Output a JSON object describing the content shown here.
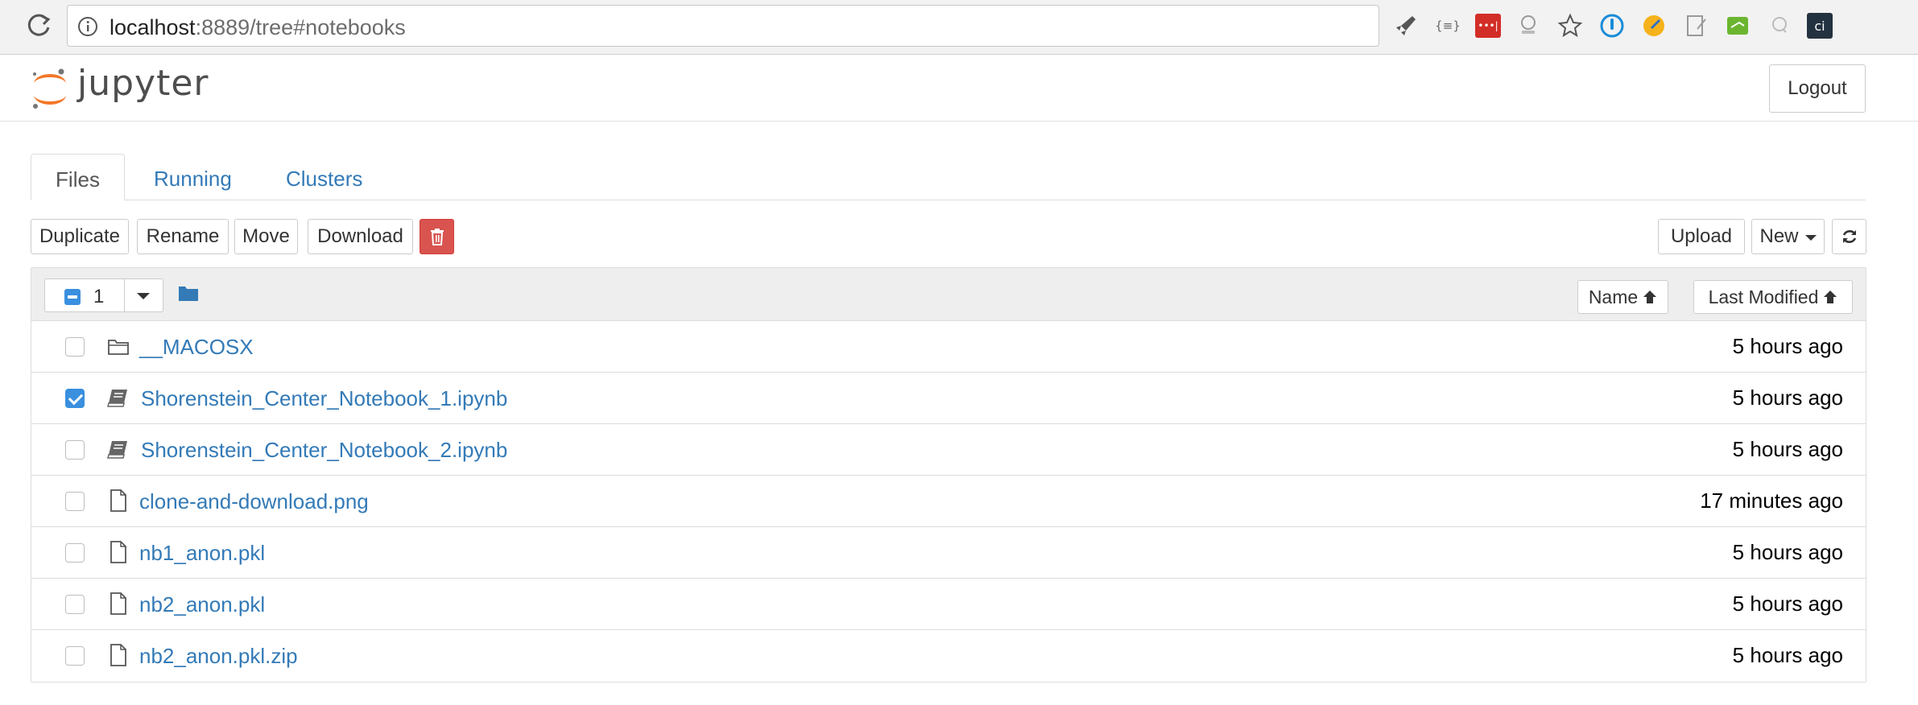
{
  "browser": {
    "url_host": "localhost",
    "url_rest": ":8889/tree#notebooks",
    "extensions": [
      "rocket-icon",
      "braces-icon",
      "lastpass-icon",
      "extension-icon",
      "star-icon",
      "onepassword-icon",
      "rocket-color-icon",
      "notes-icon",
      "evernote-icon",
      "chat-icon",
      "ci-icon"
    ],
    "ci_label": "ci",
    "braces_label": "{≡}",
    "lastpass_label": "•••|"
  },
  "header": {
    "logo_text": "jupyter",
    "logout_label": "Logout"
  },
  "tabs": [
    {
      "label": "Files",
      "active": true
    },
    {
      "label": "Running",
      "active": false
    },
    {
      "label": "Clusters",
      "active": false
    }
  ],
  "toolbar": {
    "duplicate_label": "Duplicate",
    "rename_label": "Rename",
    "move_label": "Move",
    "download_label": "Download",
    "upload_label": "Upload",
    "new_label": "New"
  },
  "list_header": {
    "selected_count": "1",
    "name_sort_label": "Name",
    "modified_sort_label": "Last Modified"
  },
  "files": [
    {
      "name": "__MACOSX",
      "type": "folder",
      "modified": "5 hours ago",
      "checked": false
    },
    {
      "name": "Shorenstein_Center_Notebook_1.ipynb",
      "type": "notebook",
      "modified": "5 hours ago",
      "checked": true
    },
    {
      "name": "Shorenstein_Center_Notebook_2.ipynb",
      "type": "notebook",
      "modified": "5 hours ago",
      "checked": false
    },
    {
      "name": "clone-and-download.png",
      "type": "file",
      "modified": "17 minutes ago",
      "checked": false
    },
    {
      "name": "nb1_anon.pkl",
      "type": "file",
      "modified": "5 hours ago",
      "checked": false
    },
    {
      "name": "nb2_anon.pkl",
      "type": "file",
      "modified": "5 hours ago",
      "checked": false
    },
    {
      "name": "nb2_anon.pkl.zip",
      "type": "file",
      "modified": "5 hours ago",
      "checked": false
    }
  ],
  "colors": {
    "link": "#337ab7",
    "accent_orange": "#f37726",
    "danger": "#d9534f",
    "checkbox": "#3a8fde"
  }
}
